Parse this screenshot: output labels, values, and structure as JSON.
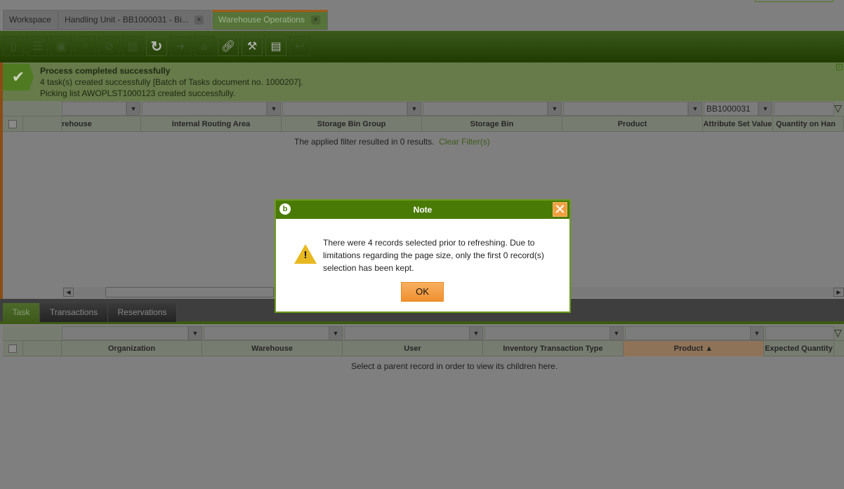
{
  "tabs": [
    {
      "label": "Workspace"
    },
    {
      "label": "Handling Unit - BB1000031 - Bi...",
      "close": "×"
    },
    {
      "label": "Warehouse Operations",
      "close": "×"
    }
  ],
  "toolbar": {
    "icons": [
      "new-document",
      "new-row",
      "save",
      "delete-row",
      "cancel",
      "trash",
      "refresh",
      "export",
      "attachment",
      "link",
      "tools",
      "layout",
      "undo"
    ]
  },
  "message": {
    "title": "Process completed successfully",
    "line1": "4 task(s) created successfully [Batch of Tasks document no. 1000207].",
    "line2": "Picking list AWOPLST1000123 created successfully."
  },
  "top_grid": {
    "filter_value": "BB1000031",
    "columns": [
      "rehouse",
      "Internal Routing Area",
      "Storage Bin Group",
      "Storage Bin",
      "Product",
      "Attribute Set Value",
      "Quantity on Han"
    ],
    "empty_text": "The applied filter resulted in 0 results.",
    "clear_filter": "Clear Filter(s)"
  },
  "bottom_tabs": [
    "Task",
    "Transactions",
    "Reservations"
  ],
  "bottom_grid": {
    "columns": [
      "Organization",
      "Warehouse",
      "User",
      "Inventory Transaction Type",
      "Product ▲",
      "Expected Quantity"
    ],
    "empty_text": "Select a parent record in order to view its children here."
  },
  "dialog": {
    "title": "Note",
    "text": "There were 4 records selected prior to refreshing. Due to limitations regarding the page size, only the first 0 record(s) selection has been kept.",
    "ok": "OK"
  }
}
